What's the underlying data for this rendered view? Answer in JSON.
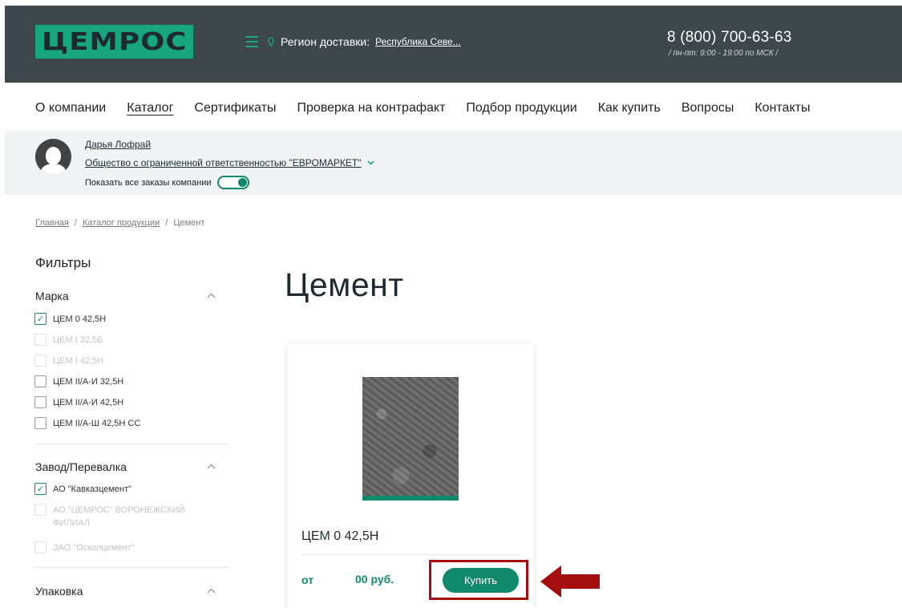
{
  "header": {
    "logo": "ЦЕМРОС",
    "region_label": "Регион доставки:",
    "region_value": "Республика Севе...",
    "phone": "8 (800) 700-63-63",
    "hours": "/ пн-пт: 9:00 - 19:00 по МСК /"
  },
  "nav": {
    "items": [
      "О компании",
      "Каталог",
      "Сертификаты",
      "Проверка на контрафакт",
      "Подбор продукции",
      "Как купить",
      "Вопросы",
      "Контакты"
    ],
    "active": "Каталог"
  },
  "user": {
    "name": "Дарья Лофрай",
    "company": "Общество с ограниченной ответственностью \"ЕВРОМАРКЕТ\"",
    "show_all_label": "Показать все заказы компании",
    "show_all_enabled": true
  },
  "breadcrumb": [
    "Главная",
    "Каталог продукции",
    "Цемент"
  ],
  "filters": {
    "title": "Фильтры",
    "groups": [
      {
        "title": "Марка",
        "options": [
          {
            "label": "ЦЕМ 0 42,5Н",
            "checked": true,
            "disabled": false
          },
          {
            "label": "ЦЕМ I 32,5Б",
            "checked": false,
            "disabled": true
          },
          {
            "label": "ЦЕМ I 42,5Н",
            "checked": false,
            "disabled": true
          },
          {
            "label": "ЦЕМ II/А-И 32,5Н",
            "checked": false,
            "disabled": false
          },
          {
            "label": "ЦЕМ II/А-И 42,5Н",
            "checked": false,
            "disabled": false
          },
          {
            "label": "ЦЕМ II/А-Ш 42,5Н СС",
            "checked": false,
            "disabled": false
          }
        ]
      },
      {
        "title": "Завод/Перевалка",
        "options": [
          {
            "label": "АО \"Кавказцемент\"",
            "checked": true,
            "disabled": false
          },
          {
            "label": "АО \"ЦЕМРОС\" ВОРОНЕЖСКИЙ ФИЛИАЛ",
            "checked": false,
            "disabled": true
          },
          {
            "label": "ЗАО \"Осколцемент\"",
            "checked": false,
            "disabled": true
          }
        ]
      },
      {
        "title": "Упаковка",
        "options": []
      }
    ]
  },
  "content": {
    "title": "Цемент",
    "product": {
      "name": "ЦЕМ 0 42,5Н",
      "price_from": "от",
      "price": "00 руб.",
      "buy_label": "Купить"
    }
  },
  "colors": {
    "header_bg": "#3d474c",
    "brand_green": "#17a67d",
    "accent": "#0f8a6c",
    "annotation_red": "#a50e0e"
  }
}
